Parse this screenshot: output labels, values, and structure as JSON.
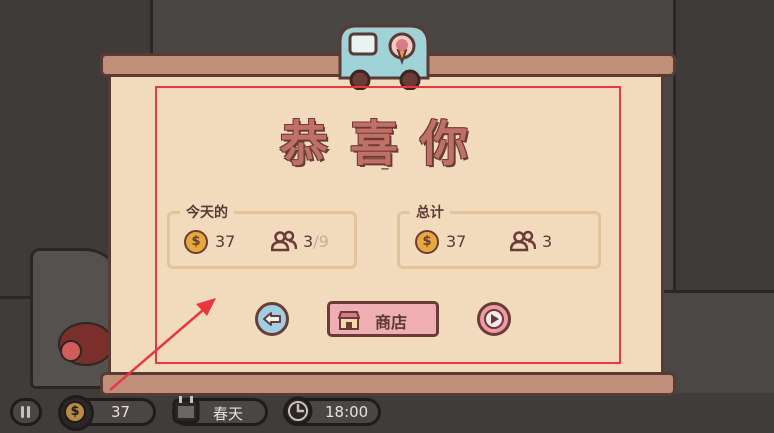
{
  "popup": {
    "title": "恭喜你",
    "subtitle": "–"
  },
  "today": {
    "label": "今天的",
    "money": "37",
    "customers": "3",
    "customers_total": "/9"
  },
  "total": {
    "label": "总计",
    "money": "37",
    "customers": "3"
  },
  "buttons": {
    "shop_label": "商店"
  },
  "hud": {
    "money": "37",
    "season": "春天",
    "time": "18:00"
  },
  "icons": {
    "coin": "dollar-coin-icon",
    "customers": "people-icon",
    "back": "back-arrow-icon",
    "next": "play-icon",
    "shop": "store-icon",
    "pause": "pause-icon",
    "calendar": "calendar-icon",
    "clock": "clock-icon"
  },
  "colors": {
    "highlight": "#e8383d",
    "paper": "#f2dbbd",
    "title": "#c07066",
    "coin": "#e6a93c"
  }
}
